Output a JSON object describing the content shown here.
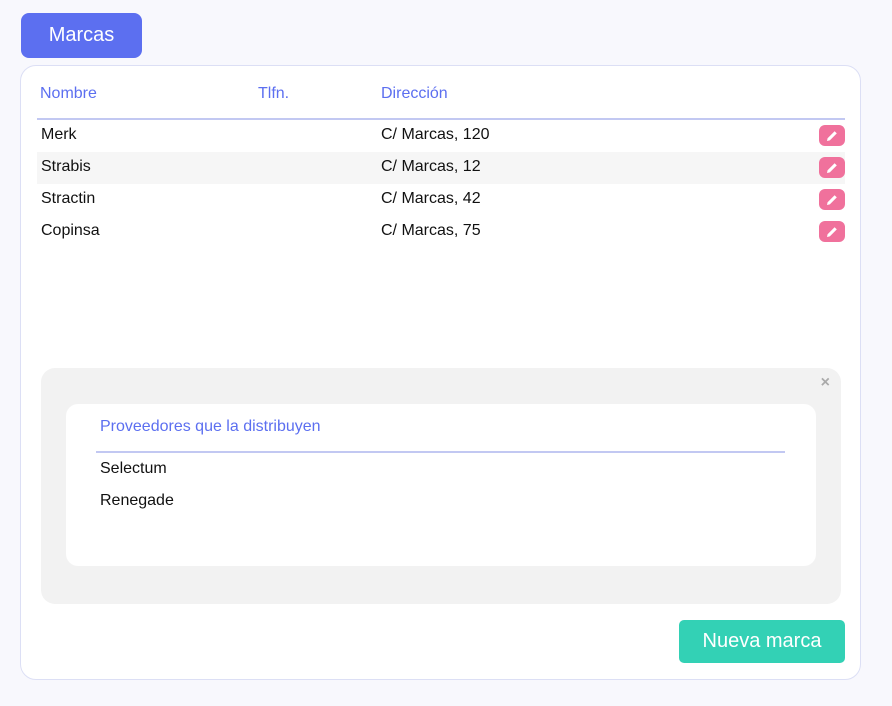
{
  "header": {
    "title": "Marcas"
  },
  "table": {
    "columns": [
      "Nombre",
      "Tlfn.",
      "Dirección"
    ],
    "rows": [
      {
        "nombre": "Merk",
        "tlfn": "",
        "direccion": "C/ Marcas, 120"
      },
      {
        "nombre": "Strabis",
        "tlfn": "",
        "direccion": "C/ Marcas, 12"
      },
      {
        "nombre": "Stractin",
        "tlfn": "",
        "direccion": "C/ Marcas, 42"
      },
      {
        "nombre": "Copinsa",
        "tlfn": "",
        "direccion": "C/ Marcas, 75"
      }
    ],
    "edit_icon": "pencil-icon"
  },
  "detail": {
    "close_label": "×",
    "heading": "Proveedores que la distribuyen",
    "providers": [
      "Selectum",
      "Renegade"
    ]
  },
  "actions": {
    "new_label": "Nueva marca"
  },
  "colors": {
    "accent": "#5c6ff0",
    "edit": "#f0719c",
    "primary_action": "#33d1b5"
  }
}
